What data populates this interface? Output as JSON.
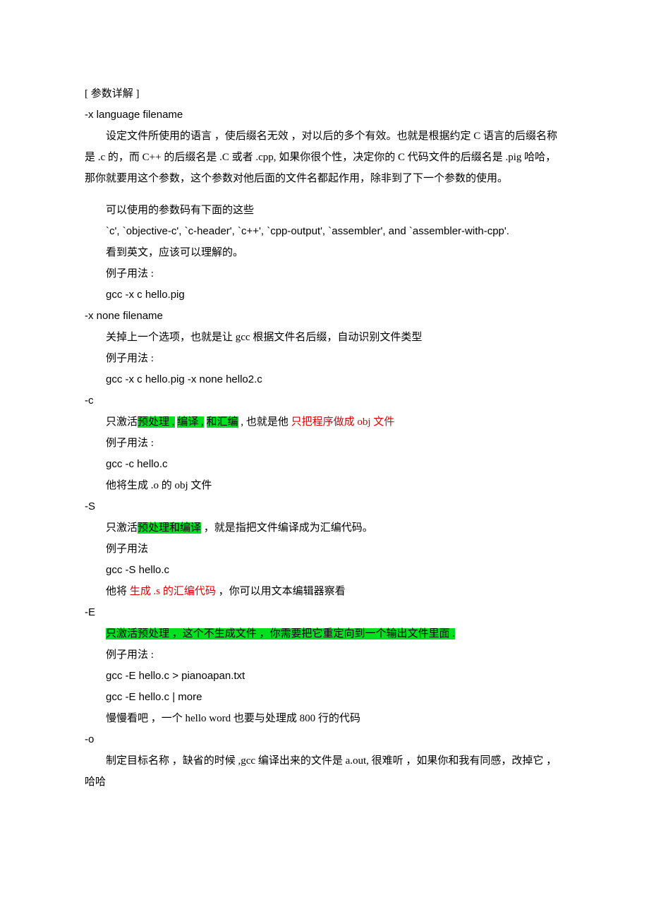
{
  "header": "[ 参数详解 ]",
  "s_xlang": {
    "flag": "-x language filename",
    "p1": "设定文件所使用的语言 ，使后缀名无效 ，对以后的多个有效。也就是根据约定 C 语言的后缀名称是 .c 的，而 C++ 的后缀名是 .C 或者 .cpp, 如果你很个性，决定你的 C 代码文件的后缀名是 .pig 哈哈，那你就要用这个参数，这个参数对他后面的文件名都起作用，除非到了下一个参数的使用。",
    "p2": "可以使用的参数码有下面的这些",
    "p3": " `c', `objective-c', `c-header', `c++', `cpp-output', `assembler', and `assembler-with-cpp'.",
    "p4": "看到英文，应该可以理解的。",
    "p5": "例子用法 :",
    "p6": " gcc -x c hello.pig"
  },
  "s_xnone": {
    "flag": "-x none filename",
    "p1": "关掉上一个选项，也就是让 gcc 根据文件名后缀，自动识别文件类型",
    "p2": "例子用法 :",
    "p3": " gcc -x c hello.pig -x none hello2.c"
  },
  "s_c": {
    "flag": "-c",
    "p1_a": "只激活",
    "p1_b": "预处理 ,",
    "p1_c": " ",
    "p1_d": "编译 ,",
    "p1_e": " ",
    "p1_f": "和汇编",
    "p1_g": " , 也就是他 ",
    "p1_h": "只把程序做成 obj 文件",
    "p2": "例子用法 :",
    "p3": " gcc -c hello.c",
    "p4": "他将生成 .o 的 obj 文件"
  },
  "s_S": {
    "flag": "-S",
    "p1_a": "只激活",
    "p1_b": "预处理和编译",
    "p1_c": " ，就是指把文件编译成为汇编代码。",
    "p2": "例子用法",
    "p3": " gcc -S hello.c",
    "p4_a": "他将 ",
    "p4_b": "生成 .s 的汇编代码",
    "p4_c": " ，你可以用文本编辑器察看"
  },
  "s_E": {
    "flag": "-E",
    "p1": "只激活预处理 ，这个不生成文件 ，你需要把它重定向到一个输出文件里面 .",
    "p2": "例子用法 :",
    "p3": " gcc -E hello.c > pianoapan.txt",
    "p4": " gcc -E hello.c | more",
    "p5": "慢慢看吧 ，一个 hello word 也要与处理成 800 行的代码"
  },
  "s_o": {
    "flag": "-o",
    "p1": "制定目标名称 ，缺省的时候 ,gcc 编译出来的文件是 a.out, 很难听 ，如果你和我有同感，改掉它 ，哈哈"
  }
}
